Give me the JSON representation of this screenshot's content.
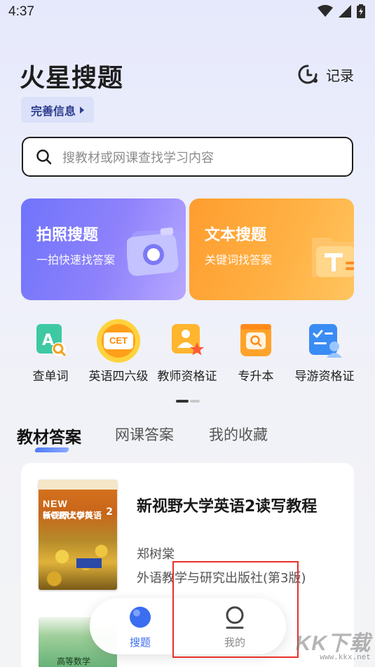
{
  "status_bar": {
    "time": "4:37"
  },
  "header": {
    "app_title": "火星搜题",
    "record_label": "记录",
    "profile_chip": "完善信息"
  },
  "search": {
    "placeholder": "搜教材或网课查找学习内容"
  },
  "feature_cards": [
    {
      "title": "拍照搜题",
      "subtitle": "一拍快速找答案"
    },
    {
      "title": "文本搜题",
      "subtitle": "关键词找答案"
    }
  ],
  "shortcuts": [
    {
      "label": "查单词",
      "icon": "word-lookup-icon"
    },
    {
      "label": "英语四六级",
      "icon": "cet-icon",
      "badge": "CET"
    },
    {
      "label": "教师资格证",
      "icon": "teacher-cert-icon"
    },
    {
      "label": "专升本",
      "icon": "upgrade-degree-icon"
    },
    {
      "label": "导游资格证",
      "icon": "tour-guide-cert-icon"
    }
  ],
  "tabs": [
    {
      "label": "教材答案",
      "active": true
    },
    {
      "label": "网课答案",
      "active": false
    },
    {
      "label": "我的收藏",
      "active": false
    }
  ],
  "books": [
    {
      "title": "新视野大学英语2读写教程",
      "author": "郑树棠",
      "publisher": "外语教学与研究出版社(第3版)",
      "cover": {
        "brand": "NEW HORIZON",
        "cn_title": "新视野大学英语",
        "volume": "2"
      }
    },
    {
      "cover": {
        "label": "高等数学"
      }
    }
  ],
  "bottom_nav": [
    {
      "label": "搜题",
      "active": true
    },
    {
      "label": "我的",
      "active": false
    }
  ],
  "watermark": {
    "text": "KK下载",
    "url": "www.kkx.net"
  },
  "colors": {
    "accent_blue": "#3b6df0",
    "photo_card": "#7b79fb",
    "text_card": "#ffa53a",
    "highlight_red": "#e8302a"
  }
}
